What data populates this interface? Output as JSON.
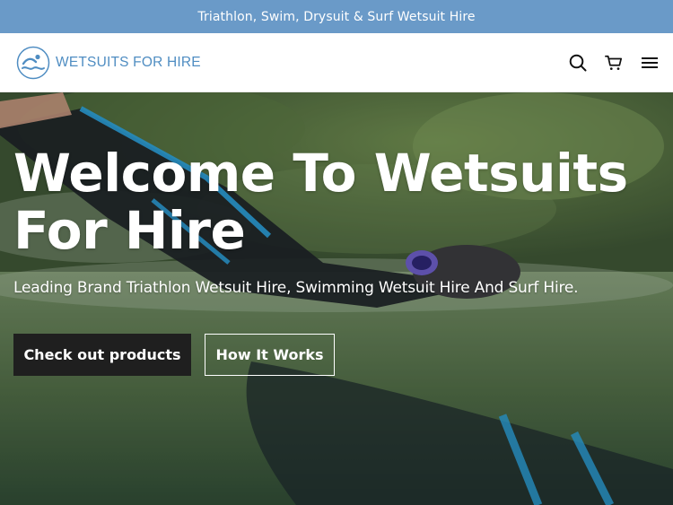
{
  "announcement": {
    "text": "Triathlon, Swim, Drysuit & Surf Wetsuit Hire"
  },
  "header": {
    "logo_text": "WETSUITS FOR HIRE",
    "icons": [
      "search-icon",
      "cart-icon",
      "menu-icon"
    ]
  },
  "hero": {
    "title": "Welcome To Wetsuits For Hire",
    "subtitle": "Leading Brand Triathlon Wetsuit Hire, Swimming Wetsuit Hire And Surf Hire.",
    "primary_button": "Check out products",
    "secondary_button": "How It Works"
  },
  "colors": {
    "announcement_bg": "#6a9ac8",
    "logo_blue": "#4f8dc2",
    "primary_button_bg": "#1f1f1f"
  }
}
